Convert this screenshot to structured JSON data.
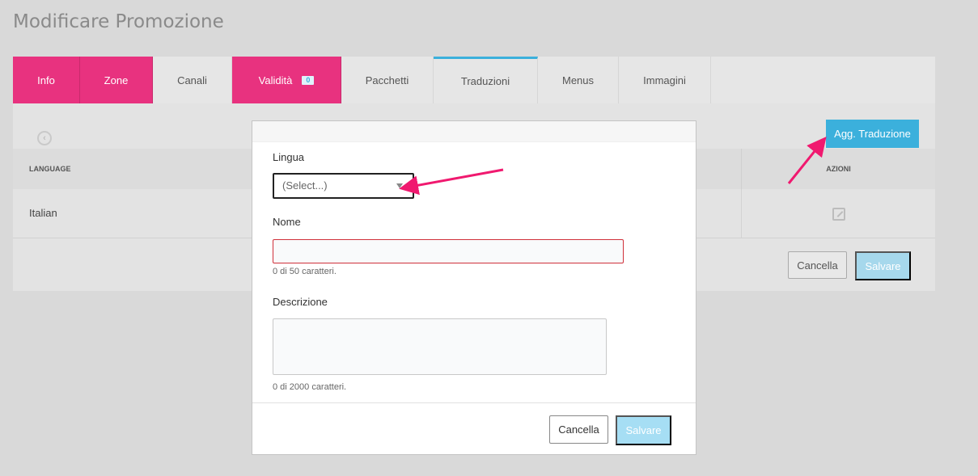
{
  "page": {
    "title": "Modificare Promozione"
  },
  "tabs": [
    {
      "label": "Info"
    },
    {
      "label": "Zone"
    },
    {
      "label": "Canali"
    },
    {
      "label": "Validità",
      "badge": "0"
    },
    {
      "label": "Pacchetti"
    },
    {
      "label": "Traduzioni"
    },
    {
      "label": "Menus"
    },
    {
      "label": "Immagini"
    }
  ],
  "panel": {
    "add_button": "Agg. Traduzione",
    "columns": {
      "language": "LANGUAGE",
      "actions": "AZIONI"
    },
    "rows": [
      {
        "language": "Italian"
      }
    ],
    "cancel": "Cancella",
    "save": "Salvare"
  },
  "modal": {
    "language_label": "Lingua",
    "language_value": "(Select...)",
    "name_label": "Nome",
    "name_hint": "0 di 50 caratteri.",
    "description_label": "Descrizione",
    "description_hint": "0 di 2000 caratteri.",
    "cancel": "Cancella",
    "save": "Salvare"
  },
  "colors": {
    "tab_pink": "#e8327f",
    "accent_blue": "#3bb0dc",
    "arrow": "#f0196f",
    "error_border": "#d0303a"
  }
}
